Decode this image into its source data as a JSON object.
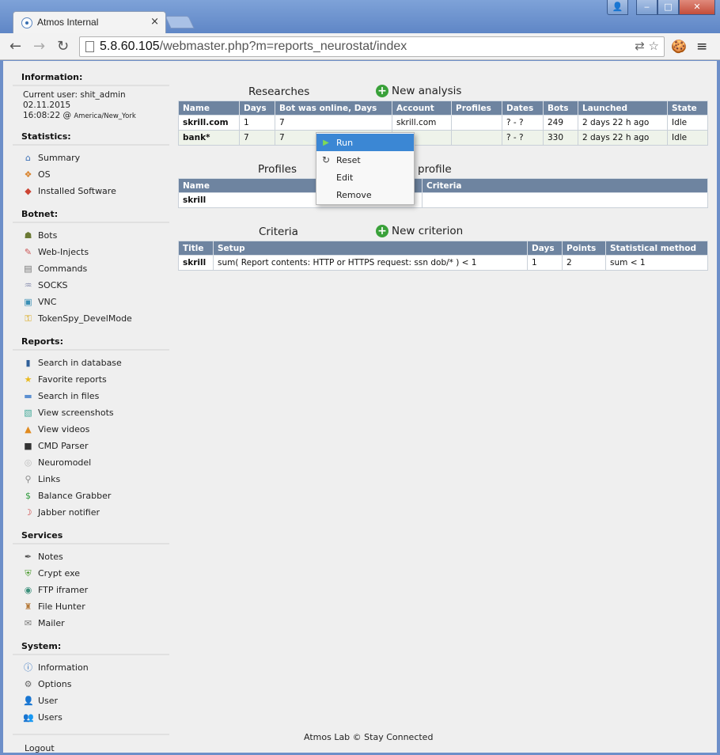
{
  "browser": {
    "tab_title": "Atmos Internal",
    "tab_close": "×",
    "url_host": "5.8.60.105",
    "url_path": "/webmaster.php?m=reports_neurostat/index",
    "back": "←",
    "forward": "→",
    "reload": "↻",
    "window_buttons": {
      "user": "👤",
      "minimize": "‒",
      "maximize": "□",
      "close": "✕"
    }
  },
  "sidebar": {
    "information": {
      "heading": "Information:",
      "current_user": "Current user: shit_admin",
      "date": "02.11.2015",
      "time": "16:08:22 @",
      "timezone": "America/New_York"
    },
    "statistics": {
      "heading": "Statistics:",
      "items": [
        "Summary",
        "OS",
        "Installed Software"
      ]
    },
    "botnet": {
      "heading": "Botnet:",
      "items": [
        "Bots",
        "Web-Injects",
        "Commands",
        "SOCKS",
        "VNC",
        "TokenSpy_DevelMode"
      ]
    },
    "reports": {
      "heading": "Reports:",
      "items": [
        "Search in database",
        "Favorite reports",
        "Search in files",
        "View screenshots",
        "View videos",
        "CMD Parser",
        "Neuromodel",
        "Links",
        "Balance Grabber",
        "Jabber notifier"
      ]
    },
    "services": {
      "heading": "Services",
      "items": [
        "Notes",
        "Crypt exe",
        "FTP iframer",
        "File Hunter",
        "Mailer"
      ]
    },
    "system": {
      "heading": "System:",
      "items": [
        "Information",
        "Options",
        "User",
        "Users"
      ]
    },
    "logout": "Logout"
  },
  "researches": {
    "title": "Researches",
    "add_label": "New analysis",
    "columns": [
      "Name",
      "Days",
      "Bot was online, Days",
      "Account",
      "Profiles",
      "Dates",
      "Bots",
      "Launched",
      "State"
    ],
    "rows": [
      [
        "skrill.com",
        "1",
        "7",
        "skrill.com",
        "",
        "? - ?",
        "249",
        "2 days 22 h ago",
        "Idle"
      ],
      [
        "bank*",
        "7",
        "7",
        "",
        "",
        "? - ?",
        "330",
        "2 days 22 h ago",
        "Idle"
      ]
    ]
  },
  "profiles": {
    "title": "Profiles",
    "add_label": "profile",
    "columns": [
      "Name",
      "Criteria"
    ],
    "rows": [
      [
        "skrill",
        ""
      ]
    ]
  },
  "criteria": {
    "title": "Criteria",
    "add_label": "New criterion",
    "columns": [
      "Title",
      "Setup",
      "Days",
      "Points",
      "Statistical method"
    ],
    "rows": [
      [
        "skrill",
        "sum( Report contents: HTTP or HTTPS request: ssn dob/* ) < 1",
        "1",
        "2",
        "sum < 1"
      ]
    ]
  },
  "context_menu": {
    "items": [
      "Run",
      "Reset",
      "Edit",
      "Remove"
    ],
    "active": "Run"
  },
  "footer": "Atmos Lab © Stay Connected"
}
